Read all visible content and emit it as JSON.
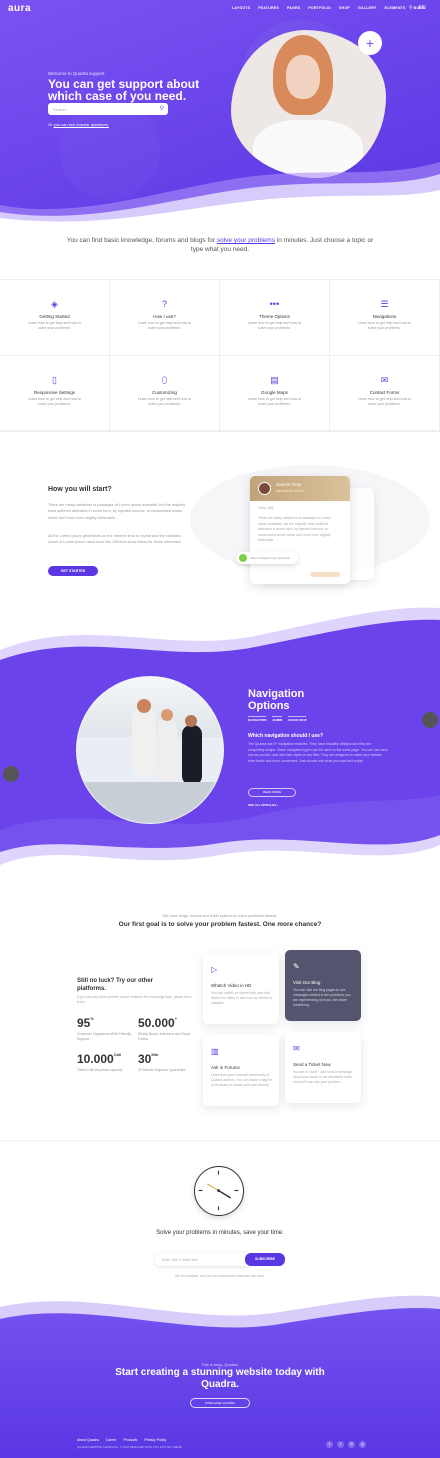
{
  "brand": {
    "logo": "aura"
  },
  "nav": {
    "items": [
      "LAYOUTS",
      "FEATURES",
      "PAGES",
      "PORTFOLIO",
      "SHOP",
      "GALLERY",
      "ELEMENTS",
      "BUDS"
    ],
    "lang": "EN"
  },
  "hero": {
    "welcome": "Welcome to Quadra support.",
    "title": "You can get support about which case of you need.",
    "search_placeholder": "Search...",
    "link_prefix": "Or ",
    "link_text": "you can see popular questions."
  },
  "intro": {
    "pre": "You can find basic knowledge, forums and blogs for ",
    "link": "solve your problems",
    "post": " in minutes. Just choose a topic or type what you need."
  },
  "features": [
    {
      "title": "Getting Started",
      "desc": "Learn how to get help and how to solve your problems.",
      "icon": "layers-icon",
      "glyph": "◈"
    },
    {
      "title": "How I use?",
      "desc": "Learn how to get help and how to solve your problems.",
      "icon": "question-icon",
      "glyph": "?"
    },
    {
      "title": "Theme Options",
      "desc": "Learn how to get help and how to solve your problems.",
      "icon": "dots-icon",
      "glyph": "•••"
    },
    {
      "title": "Navigations",
      "desc": "Learn how to get help and how to solve your problems.",
      "icon": "list-icon",
      "glyph": "☰"
    },
    {
      "title": "Responsive Settings",
      "desc": "Learn how to get help and how to solve your problems.",
      "icon": "mobile-icon",
      "glyph": "▯"
    },
    {
      "title": "Customizing",
      "desc": "Learn how to get help and how to solve your problems.",
      "icon": "mouse-icon",
      "glyph": "⬯"
    },
    {
      "title": "Google Maps",
      "desc": "Learn how to get help and how to solve your problems.",
      "icon": "map-icon",
      "glyph": "▤"
    },
    {
      "title": "Contact Forms",
      "desc": "Learn how to get help and how to solve your problems.",
      "icon": "envelope-icon",
      "glyph": "✉"
    }
  ],
  "how": {
    "title": "How you will start?",
    "p1": "There are many variations of passages of Lorem Ipsum available, but the majority have suffered alteration in some form, by injected humour, or randomised words which don't look even slightly believable.",
    "p2": "All the Lorem Ipsum generators on the Internet tend to repeat and the standard chunk of Lorem Ipsum used since the 1500s is show below for those interested.",
    "button": "GET STARTED"
  },
  "card": {
    "name": "Jasmin Grey",
    "subtitle": "Installing the theme",
    "greeting": "Hello, Jeff,",
    "body": "There are many variations of passages of Lorem Ipsum available, but the majority have suffered alteration in some form, by injected humour, or randomised words which don't look even slightly believable.",
    "chip": "Jasmin Replied Your Question"
  },
  "navopt": {
    "title": "Navigation Options",
    "tabs": [
      "NAVIGATION",
      "ADMIN",
      "29 NOV 2018"
    ],
    "question": "Which navigation should I use?",
    "body": "The Quadra has 9+ navigation modules. They have beautiful designs and they are completely unique. Some navigation types can be used on the same page. You can use each one as you like, and add their styles to any files. They are designed to make your website even faster and more convenient. Just choose one what you want and enjoy!",
    "button": "READ MORE",
    "link": "SEE ALL ARTICLES ›"
  },
  "stats": {
    "small": "We have blogs, forums and ticket system for solve problems fastest.",
    "big": "Our first goal is to solve your problem fastest. One more chance?",
    "luck_title": "Still no luck? Try our other platforms.",
    "luck_desc": "If you have any other problem doesn't featured the knowledge base, please let us know.",
    "items": [
      {
        "num": "95",
        "unit": "%",
        "label": "Customer Happiness With Friendly Support"
      },
      {
        "num": "50.000",
        "unit": "+",
        "label": "Ready Books followers and Super Forms"
      },
      {
        "num": "10.000",
        "unit": "Call",
        "label": "Ticket Call response capacity"
      },
      {
        "num": "30",
        "unit": "Min",
        "label": "20 Minute response guarantee."
      }
    ]
  },
  "tiles": [
    {
      "title": "Whatch Video in HD",
      "desc": "You can install our theme with one click. Watch the video to see how our theme is installed.",
      "icon": "play-icon",
      "glyph": "▷",
      "dark": false
    },
    {
      "title": "Visit Our Blog",
      "desc": "You can visit our blog pages to see messages related to the problems you are experiencing and you can share something.",
      "icon": "edit-icon",
      "glyph": "✎",
      "dark": true
    },
    {
      "title": "Ask in Forums",
      "desc": "Learn from your relevant community of Quadra authors. You can share a flag for your issues or create your own thread!",
      "icon": "book-icon",
      "glyph": "▥",
      "dark": false
    },
    {
      "title": "Send a Ticket Now",
      "desc": "You are in stuck? Just send a message about your issue to our developer team and we'll look into your problem.",
      "icon": "mail-icon",
      "glyph": "✉",
      "dark": false
    }
  ],
  "subscribe": {
    "title": "Solve your problems in minutes, save your time.",
    "placeholder": "Enter Your E-Mail Here",
    "button": "SUBSCRIBE",
    "note": "We do not spam, and you can unsubscribe whenever you want."
  },
  "footer": {
    "small": "This is easy, Quadra.",
    "title": "Start creating a stunning website today with Quadra.",
    "button": "PURCHASE QUADRA",
    "links": [
      "About Quadra",
      "Career",
      "Products",
      "Privacy Policy"
    ],
    "copy": "QUADRA WEBSITE TEMPLATE - © 2018 DESIGNED WITH ♥ BY DUOTEL THEME",
    "social": [
      "f",
      "t",
      "in",
      "g"
    ]
  },
  "colors": {
    "primary": "#5a37e3",
    "primary_light": "#7a52f2",
    "dark_tile": "#54546e"
  }
}
